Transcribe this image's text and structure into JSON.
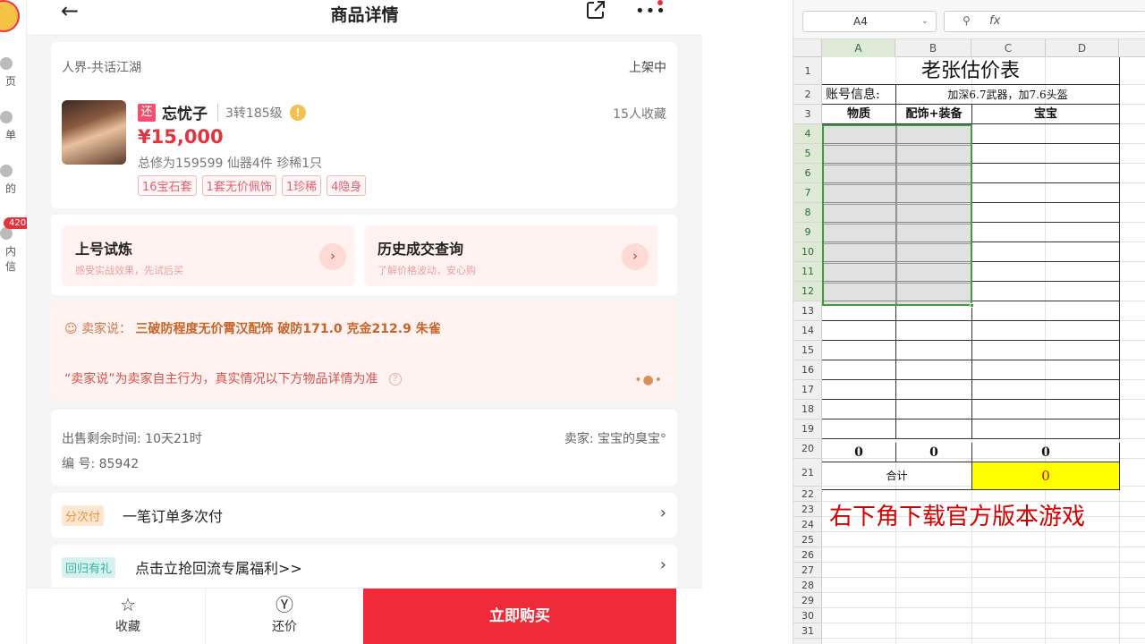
{
  "sidebar": {
    "items": [
      {
        "label": "页",
        "icon": "home-icon"
      },
      {
        "label": "单",
        "icon": "order-icon"
      },
      {
        "label": "的",
        "icon": "profile-icon"
      },
      {
        "label": "内信",
        "icon": "message-icon"
      }
    ],
    "badge": "420"
  },
  "header": {
    "title": "商品详情",
    "back_icon": "arrow-left-icon",
    "share_icon": "share-icon",
    "more_icon": "more-icon"
  },
  "product": {
    "server": "人界-共话江湖",
    "status": "上架中",
    "tag": "还",
    "nickname": "忘忧子",
    "level": "3转185级",
    "favorites": "15人收藏",
    "price": "¥15,000",
    "stats": "总修为159599  仙器4件  珍稀1只",
    "chips": [
      "16宝石套",
      "1套无价佩饰",
      "1珍稀",
      "4隐身"
    ]
  },
  "actions": {
    "trial": {
      "title": "上号试炼",
      "subtitle": "感受实战效果，先试后买"
    },
    "history": {
      "title": "历史成交查询",
      "subtitle": "了解价格波动，安心购"
    }
  },
  "seller_notes": {
    "label": "卖家说：",
    "text": "三破防程度无价霄汉配饰 破防171.0 克金212.9 朱雀",
    "disclaimer": "“卖家说”为卖家自主行为，真实情况以下方物品详情为准"
  },
  "sale_info": {
    "remaining": "出售剩余时间: 10天21时",
    "seller": "卖家: 宝宝的臭宝°",
    "serial": "编 号: 85942"
  },
  "promos": [
    {
      "tag": "分次付",
      "text": "一笔订单多次付"
    },
    {
      "tag": "回归有礼",
      "text": "点击立抢回流专属福利>>"
    }
  ],
  "bottom": {
    "favorite": "收藏",
    "bargain": "还价",
    "buy": "立即购买"
  },
  "sheet": {
    "name_box": "A4",
    "fx_label": "fx",
    "columns": [
      "A",
      "B",
      "C",
      "D"
    ],
    "rows": [
      "1",
      "2",
      "3",
      "4",
      "5",
      "6",
      "7",
      "8",
      "9",
      "10",
      "11",
      "12",
      "13",
      "14",
      "15",
      "16",
      "17",
      "18",
      "19",
      "20",
      "21",
      "22",
      "23",
      "24",
      "25",
      "26",
      "27",
      "28",
      "29",
      "30",
      "31"
    ],
    "title": "老张估价表",
    "account_label": "账号信息:",
    "account_value": "加深6.7武器，加7.6头盔",
    "col_headers": [
      "物质",
      "配饰+装备",
      "宝宝"
    ],
    "sum_a": "0",
    "sum_b": "0",
    "sum_c": "0",
    "total_label": "合计",
    "total_value": "0",
    "ad_text": "右下角下载官方版本游戏",
    "colors": {
      "selection": "#3f9b3f",
      "highlight": "#ffff00",
      "accent": "#d40000"
    }
  }
}
